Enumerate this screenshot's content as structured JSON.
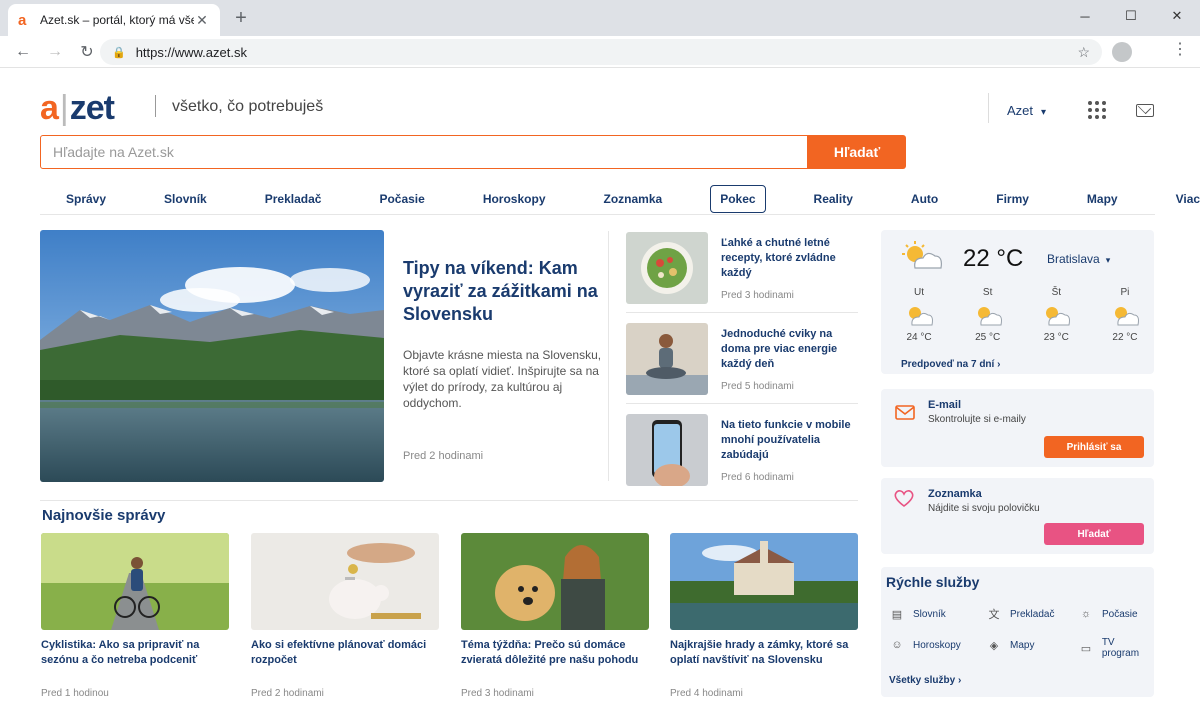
{
  "browser": {
    "tab_title": "Azet.sk – portál, ktorý má všetko",
    "url": "https://www.azet.sk"
  },
  "header": {
    "logo_a": "a",
    "logo_zet": "zet",
    "tagline": "všetko, čo potrebuješ",
    "account_label": "Azet"
  },
  "search": {
    "placeholder": "Hľadajte na Azet.sk",
    "button_label": "Hľadať"
  },
  "nav": {
    "items": [
      "Správy",
      "Slovník",
      "Prekladač",
      "Počasie",
      "Horoskopy",
      "Zoznamka",
      "Pokec",
      "Reality",
      "Auto",
      "Firmy",
      "Mapy",
      "Viac"
    ],
    "active": "Pokec"
  },
  "hero": {
    "title": "Tipy na víkend: Kam vyraziť za zážitkami na Slovensku",
    "description": "Objavte krásne miesta na Slovensku, ktoré sa oplatí vidieť. Inšpirujte sa na výlet do prírody, za kultúrou aj oddychom.",
    "time": "Pred 2 hodinami"
  },
  "side_articles": [
    {
      "title": "Ľahké a chutné letné recepty, ktoré zvládne každý",
      "time": "Pred 3 hodinami"
    },
    {
      "title": "Jednoduché cviky na doma pre viac energie každý deň",
      "time": "Pred 5 hodinami"
    },
    {
      "title": "Na tieto funkcie v mobile mnohí používatelia zabúdajú",
      "time": "Pred 6 hodinami"
    }
  ],
  "latest": {
    "heading": "Najnovšie správy",
    "cards": [
      {
        "title": "Cyklistika: Ako sa pripraviť na sezónu a čo netreba podceniť",
        "time": "Pred 1 hodinou"
      },
      {
        "title": "Ako si efektívne plánovať domáci rozpočet",
        "time": "Pred 2 hodinami"
      },
      {
        "title": "Téma týždňa: Prečo sú domáce zvieratá dôležité pre našu pohodu",
        "time": "Pred 3 hodinami"
      },
      {
        "title": "Najkrajšie hrady a zámky, ktoré sa oplatí navštíviť na Slovensku",
        "time": "Pred 4 hodinami"
      }
    ]
  },
  "weather": {
    "temperature": "22 °C",
    "city": "Bratislava",
    "days": [
      {
        "day": "Ut",
        "temp": "24 °C"
      },
      {
        "day": "St",
        "temp": "25 °C"
      },
      {
        "day": "Št",
        "temp": "23 °C"
      },
      {
        "day": "Pi",
        "temp": "22 °C"
      }
    ],
    "forecast_link": "Predpoveď na 7 dní"
  },
  "email_widget": {
    "title": "E-mail",
    "subtitle": "Skontrolujte si e-maily",
    "button_label": "Prihlásiť sa"
  },
  "dating_widget": {
    "title": "Zoznamka",
    "subtitle": "Nájdite si svoju polovičku",
    "button_label": "Hľadať"
  },
  "services": {
    "heading": "Rýchle služby",
    "items": [
      "Slovník",
      "Prekladač",
      "Počasie",
      "Horoskopy",
      "Mapy",
      "TV program"
    ],
    "all_link": "Všetky služby"
  },
  "colors": {
    "brand_orange": "#f26522",
    "brand_navy": "#1a3b6e",
    "dating_pink": "#e85383"
  }
}
